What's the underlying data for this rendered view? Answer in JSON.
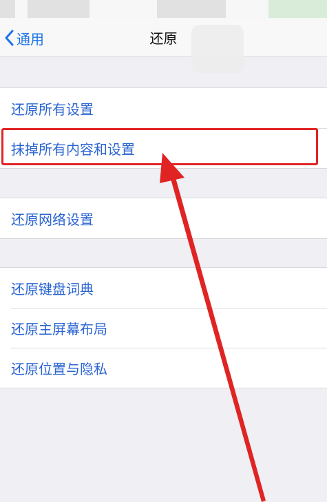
{
  "nav": {
    "back_label": "通用",
    "title": "还原"
  },
  "groups": [
    {
      "items": [
        {
          "label": "还原所有设置"
        },
        {
          "label": "抹掉所有内容和设置"
        }
      ]
    },
    {
      "items": [
        {
          "label": "还原网络设置"
        }
      ]
    },
    {
      "items": [
        {
          "label": "还原键盘词典"
        },
        {
          "label": "还原主屏幕布局"
        },
        {
          "label": "还原位置与隐私"
        }
      ]
    }
  ],
  "annotation": {
    "highlight_color": "#e02424",
    "highlighted_item": "抹掉所有内容和设置"
  },
  "colors": {
    "accent": "#2b65d1",
    "background": "#efeff4"
  }
}
